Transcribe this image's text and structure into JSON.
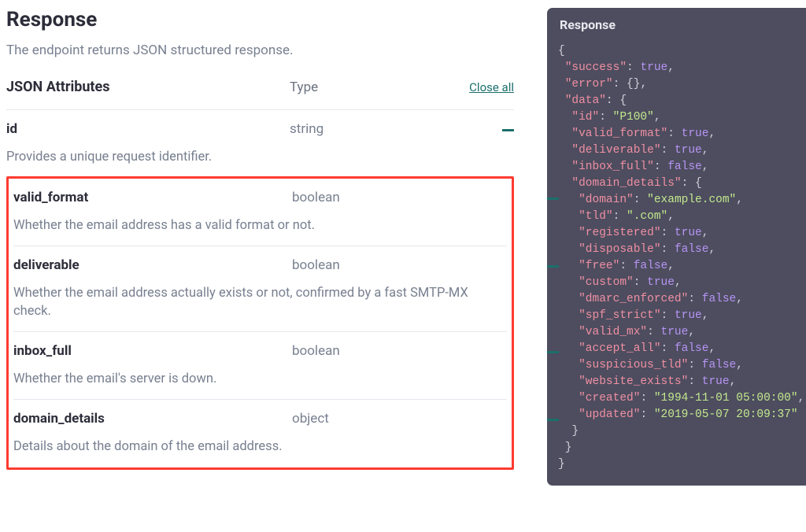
{
  "heading": "Response",
  "intro": "The endpoint returns JSON structured response.",
  "table": {
    "header_attr": "JSON Attributes",
    "header_type": "Type",
    "close_all": "Close all"
  },
  "rows": [
    {
      "name": "id",
      "type": "string",
      "desc": "Provides a unique request identifier."
    },
    {
      "name": "valid_format",
      "type": "boolean",
      "desc": "Whether the email address has a valid format or not."
    },
    {
      "name": "deliverable",
      "type": "boolean",
      "desc": "Whether the email address actually exists or not, confirmed by a fast SMTP-MX check."
    },
    {
      "name": "inbox_full",
      "type": "boolean",
      "desc": "Whether the email's server is down."
    },
    {
      "name": "domain_details",
      "type": "object",
      "desc": "Details about the domain of the email address."
    }
  ],
  "panel_title": "Response",
  "json_sample": {
    "success": true,
    "error": {},
    "data": {
      "id": "P100",
      "valid_format": true,
      "deliverable": true,
      "inbox_full": false,
      "domain_details": {
        "domain": "example.com",
        "tld": ".com",
        "registered": true,
        "disposable": false,
        "free": false,
        "custom": true,
        "dmarc_enforced": false,
        "spf_strict": true,
        "valid_mx": true,
        "accept_all": false,
        "suspicious_tld": false,
        "website_exists": true,
        "created": "1994-11-01 05:00:00",
        "updated": "2019-05-07 20:09:37"
      }
    }
  }
}
